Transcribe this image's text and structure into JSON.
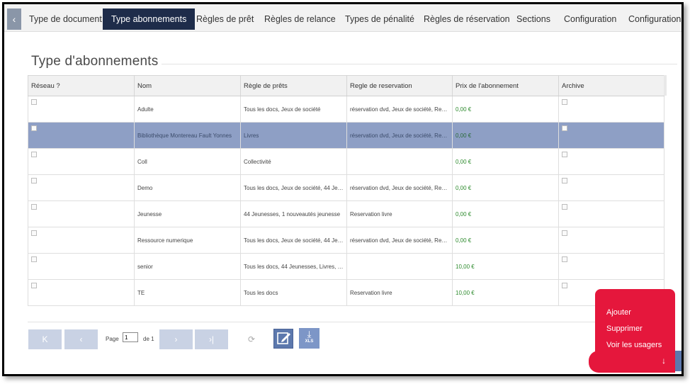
{
  "tabs": [
    {
      "label": "Type de document",
      "active": false
    },
    {
      "label": "Type abonnements",
      "active": true
    },
    {
      "label": "Règles de prêt",
      "active": false
    },
    {
      "label": "Règles de relance",
      "active": false
    },
    {
      "label": "Types de pénalité",
      "active": false
    },
    {
      "label": "Règles de réservation",
      "active": false
    },
    {
      "label": "Sections",
      "active": false
    },
    {
      "label": "Configuration",
      "active": false
    },
    {
      "label": "Configuration",
      "active": false
    }
  ],
  "back_glyph": "‹",
  "page_title": "Type d'abonnements",
  "grid": {
    "columns": [
      "Réseau ?",
      "Nom",
      "Règle de prêts",
      "Regle de reservation",
      "Prix de l'abonnement",
      "Archive"
    ],
    "rows": [
      {
        "nom": "Adulte",
        "regle_prets": "Tous les docs, Jeux de société",
        "regle_reservation": "réservation dvd, Jeux de société, Reser...",
        "prix": "0,00 €",
        "selected": false
      },
      {
        "nom": "Bibliothèque Montereau Fault Yonnes",
        "regle_prets": "Livres",
        "regle_reservation": "réservation dvd, Jeux de société, Reser...",
        "prix": "0,00 €",
        "selected": true
      },
      {
        "nom": "Coll",
        "regle_prets": "Collectivité",
        "regle_reservation": "",
        "prix": "0,00 €",
        "selected": false
      },
      {
        "nom": "Demo",
        "regle_prets": "Tous les docs, Jeux de société, 44 Jeun...",
        "regle_reservation": "réservation dvd, Jeux de société, Reser...",
        "prix": "0,00 €",
        "selected": false
      },
      {
        "nom": "Jeunesse",
        "regle_prets": "44 Jeunesses, 1 nouveautés jeunesse",
        "regle_reservation": "Reservation livre",
        "prix": "0,00 €",
        "selected": false
      },
      {
        "nom": "Ressource numerique",
        "regle_prets": "Tous les docs, Jeux de société, 44 Jeun...",
        "regle_reservation": "réservation dvd, Jeux de société, Reser...",
        "prix": "0,00 €",
        "selected": false
      },
      {
        "nom": "senior",
        "regle_prets": "Tous les docs, 44 Jeunesses, Livres, 1 n...",
        "regle_reservation": "",
        "prix": "10,00 €",
        "selected": false
      },
      {
        "nom": "TE",
        "regle_prets": "Tous les docs",
        "regle_reservation": "Reservation livre",
        "prix": "10,00 €",
        "selected": false
      }
    ]
  },
  "pager": {
    "first_glyph": "K",
    "prev_glyph": "‹",
    "next_glyph": "›",
    "last_glyph": "›|",
    "page_label": "Page",
    "page_value": "1",
    "of_label": "de 1",
    "refresh_glyph": "⟳",
    "xls_label": "XLS",
    "xls_arrow": "⤓"
  },
  "fab_menu": {
    "items": [
      "Ajouter",
      "Supprimer",
      "Voir les usagers"
    ],
    "toggle_glyph": "↓"
  },
  "colors": {
    "active_tab": "#1e2c4a",
    "selected_row": "#8e9fc5",
    "price_text": "#2e8b2e",
    "fab": "#e5173c",
    "pager_button": "#c9d2e4"
  }
}
